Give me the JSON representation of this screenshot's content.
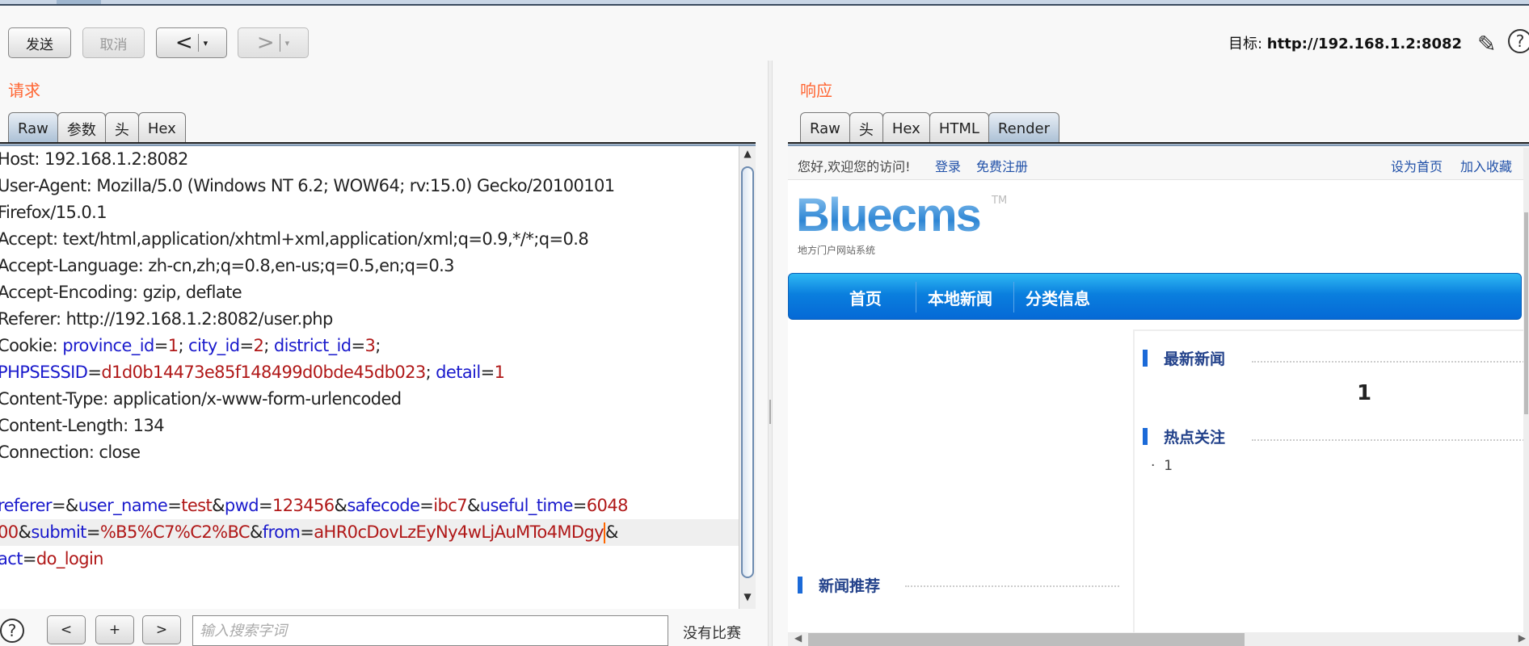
{
  "toolbar": {
    "send": "发送",
    "cancel": "取消",
    "back_arrow": "<",
    "forward_arrow": ">",
    "dropdown": "▾",
    "target_label": "目标: ",
    "target_url": "http://192.168.1.2:8082",
    "pencil_icon": "pencil-icon",
    "help_icon": "help-icon"
  },
  "request": {
    "label": "请求",
    "tabs": [
      {
        "label": "Raw",
        "active": true
      },
      {
        "label": "参数",
        "active": false
      },
      {
        "label": "头",
        "active": false
      },
      {
        "label": "Hex",
        "active": false
      }
    ],
    "lines": [
      [
        [
          "p",
          "Host: 192.168.1.2:8082"
        ]
      ],
      [
        [
          "p",
          "User-Agent: Mozilla/5.0 (Windows NT 6.2; WOW64; rv:15.0) Gecko/20100101"
        ]
      ],
      [
        [
          "p",
          "Firefox/15.0.1"
        ]
      ],
      [
        [
          "p",
          "Accept: text/html,application/xhtml+xml,application/xml;q=0.9,*/*;q=0.8"
        ]
      ],
      [
        [
          "p",
          "Accept-Language: zh-cn,zh;q=0.8,en-us;q=0.5,en;q=0.3"
        ]
      ],
      [
        [
          "p",
          "Accept-Encoding: gzip, deflate"
        ]
      ],
      [
        [
          "p",
          "Referer: http://192.168.1.2:8082/user.php"
        ]
      ],
      [
        [
          "p",
          "Cookie: "
        ],
        [
          "k",
          "province_id"
        ],
        [
          "p",
          "="
        ],
        [
          "v",
          "1"
        ],
        [
          "p",
          "; "
        ],
        [
          "k",
          "city_id"
        ],
        [
          "p",
          "="
        ],
        [
          "v",
          "2"
        ],
        [
          "p",
          "; "
        ],
        [
          "k",
          "district_id"
        ],
        [
          "p",
          "="
        ],
        [
          "v",
          "3"
        ],
        [
          "p",
          ";"
        ]
      ],
      [
        [
          "k",
          "PHPSESSID"
        ],
        [
          "p",
          "="
        ],
        [
          "v",
          "d1d0b14473e85f148499d0bde45db023"
        ],
        [
          "p",
          "; "
        ],
        [
          "k",
          "detail"
        ],
        [
          "p",
          "="
        ],
        [
          "v",
          "1"
        ]
      ],
      [
        [
          "p",
          "Content-Type: application/x-www-form-urlencoded"
        ]
      ],
      [
        [
          "p",
          "Content-Length: 134"
        ]
      ],
      [
        [
          "p",
          "Connection: close"
        ]
      ],
      [],
      [
        [
          "k",
          "referer"
        ],
        [
          "p",
          "=&"
        ],
        [
          "k",
          "user_name"
        ],
        [
          "p",
          "="
        ],
        [
          "v",
          "test"
        ],
        [
          "p",
          "&"
        ],
        [
          "k",
          "pwd"
        ],
        [
          "p",
          "="
        ],
        [
          "v",
          "123456"
        ],
        [
          "p",
          "&"
        ],
        [
          "k",
          "safecode"
        ],
        [
          "p",
          "="
        ],
        [
          "v",
          "ibc7"
        ],
        [
          "p",
          "&"
        ],
        [
          "k",
          "useful_time"
        ],
        [
          "p",
          "="
        ],
        [
          "v",
          "6048"
        ]
      ],
      [
        [
          "v",
          "00"
        ],
        [
          "p",
          "&"
        ],
        [
          "k",
          "submit"
        ],
        [
          "p",
          "="
        ],
        [
          "v",
          "%B5%C7%C2%BC"
        ],
        [
          "p",
          "&"
        ],
        [
          "k",
          "from"
        ],
        [
          "p",
          "="
        ],
        [
          "v",
          "aHR0cDovLzEyNy4wLjAuMTo4MDgy"
        ],
        [
          "c",
          ""
        ],
        [
          "p",
          "&"
        ]
      ],
      [
        [
          "k",
          "act"
        ],
        [
          "p",
          "="
        ],
        [
          "v",
          "do_login"
        ]
      ]
    ],
    "highlighted_line": 14,
    "search": {
      "help": "?",
      "prev": "<",
      "add": "+",
      "next": ">",
      "placeholder": "输入搜索字词",
      "value": "",
      "status": "没有比赛"
    }
  },
  "response": {
    "label": "响应",
    "tabs": [
      {
        "label": "Raw",
        "active": false
      },
      {
        "label": "头",
        "active": false
      },
      {
        "label": "Hex",
        "active": false
      },
      {
        "label": "HTML",
        "active": false
      },
      {
        "label": "Render",
        "active": true
      }
    ],
    "render": {
      "welcome": "您好,欢迎您的访问!",
      "login": "登录",
      "register": "免费注册",
      "set_home": "设为首页",
      "bookmark": "加入收藏",
      "logo": "Bluecms",
      "logo_tm": "TM",
      "logo_sub": "地方门户网站系统",
      "nav": [
        "首页",
        "本地新闻",
        "分类信息"
      ],
      "latest_news_title": "最新新闻",
      "latest_news_value": "1",
      "hot_title": "热点关注",
      "hot_items": [
        "1"
      ],
      "recommend_title": "新闻推荐"
    }
  },
  "colors": {
    "section_label": "#ff6633",
    "param_key": "#1a1acc",
    "param_value": "#b01818",
    "nav_blue": "#0a7fde",
    "section_title": "#22418a"
  }
}
